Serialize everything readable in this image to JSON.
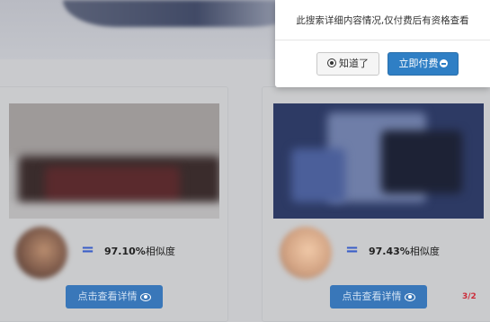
{
  "dialog": {
    "message": "此搜索详细内容情况,仅付费后有资格查看",
    "ok_label": "知道了",
    "pay_label": "立即付费"
  },
  "results": [
    {
      "similarity_value": "97.10%",
      "similarity_unit": "相似度",
      "detail_label": "点击查看详情"
    },
    {
      "similarity_value": "97.43%",
      "similarity_unit": "相似度",
      "detail_label": "点击查看详情"
    }
  ],
  "equals_symbol": "=",
  "colors": {
    "accent": "#2f7fc5",
    "equals": "#3a5ec8",
    "stamp": "#cc2d3b"
  },
  "icons": [
    "circle-dot-icon",
    "circle-arrow-icon",
    "eye-icon"
  ],
  "stamp_text": "3/2"
}
